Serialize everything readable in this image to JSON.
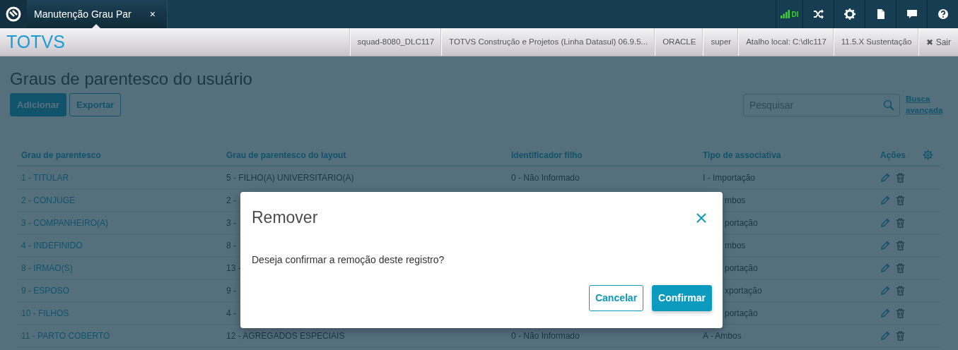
{
  "app_bar": {
    "tab": {
      "title": "Manutenção Grau Par",
      "close": "×",
      "selected": true
    },
    "status": "DI"
  },
  "header": {
    "brand": "TOTVS",
    "info": [
      "squad-8080_DLC117",
      "TOTVS Construção e Projetos (Linha Datasul) 06.9.5...",
      "ORACLE",
      "super",
      "Atalho local: C:\\dlc117",
      "11.5.X Sustentação"
    ],
    "logout": {
      "icon": "✖",
      "label": "Sair"
    }
  },
  "page": {
    "title": "Graus de parentesco do usuário",
    "buttons": [
      {
        "label": "Adicionar",
        "kind": "primary"
      },
      {
        "label": "Exportar",
        "kind": "outline"
      }
    ],
    "search": {
      "placeholder": "Pesquisar"
    },
    "advanced_search": "Busca avançada"
  },
  "table": {
    "columns": [
      "Grau de parentesco",
      "Grau de parentesco do layout",
      "Identificador filho",
      "Tipo de associativa",
      "Ações"
    ],
    "rows": [
      {
        "cells": [
          {
            "text": "1 - TITULAR"
          },
          {
            "text": "5 - FILHO(A) UNIVERSITARIO(A)"
          },
          {
            "text": "0 - Não Informado"
          },
          {
            "text": "I - Importação"
          }
        ]
      },
      {
        "cells": [
          {
            "text": "2 - CONJUGE"
          },
          {
            "text": "2 -"
          },
          null,
          {
            "text": "mbos",
            "cut": true
          }
        ]
      },
      {
        "cells": [
          {
            "text": "3 - COMPANHEIRO(A)"
          },
          {
            "text": "3 -"
          },
          null,
          {
            "text": "portação",
            "cut": true
          }
        ]
      },
      {
        "cells": [
          {
            "text": "4 - INDEFINIDO"
          },
          {
            "text": "8 -"
          },
          null,
          {
            "text": "mbos",
            "cut": true
          }
        ]
      },
      {
        "cells": [
          {
            "text": "8 - IRMAO(S)"
          },
          {
            "text": "13 -"
          },
          null,
          {
            "text": "portação",
            "cut": true
          }
        ]
      },
      {
        "cells": [
          {
            "text": "9 - ESPOSO"
          },
          {
            "text": "9 -"
          },
          null,
          {
            "text": "xportação",
            "cut": true
          }
        ]
      },
      {
        "cells": [
          {
            "text": "10 - FILHOS"
          },
          {
            "text": "4 -"
          },
          null,
          {
            "text": "portação",
            "cut": true
          }
        ]
      },
      {
        "cells": [
          {
            "text": "11 - PARTO COBERTO"
          },
          {
            "text": "12 - AGREGADOS ESPECIAIS"
          },
          {
            "text": "0 - Não Informado"
          },
          {
            "text": "A - Ambos"
          }
        ]
      }
    ]
  },
  "modal": {
    "title": "Remover",
    "message": "Deseja confirmar a remoção deste registro?",
    "buttons": [
      {
        "label": "Cancelar",
        "kind": "outline"
      },
      {
        "label": "Confirmar",
        "kind": "primary"
      }
    ]
  }
}
